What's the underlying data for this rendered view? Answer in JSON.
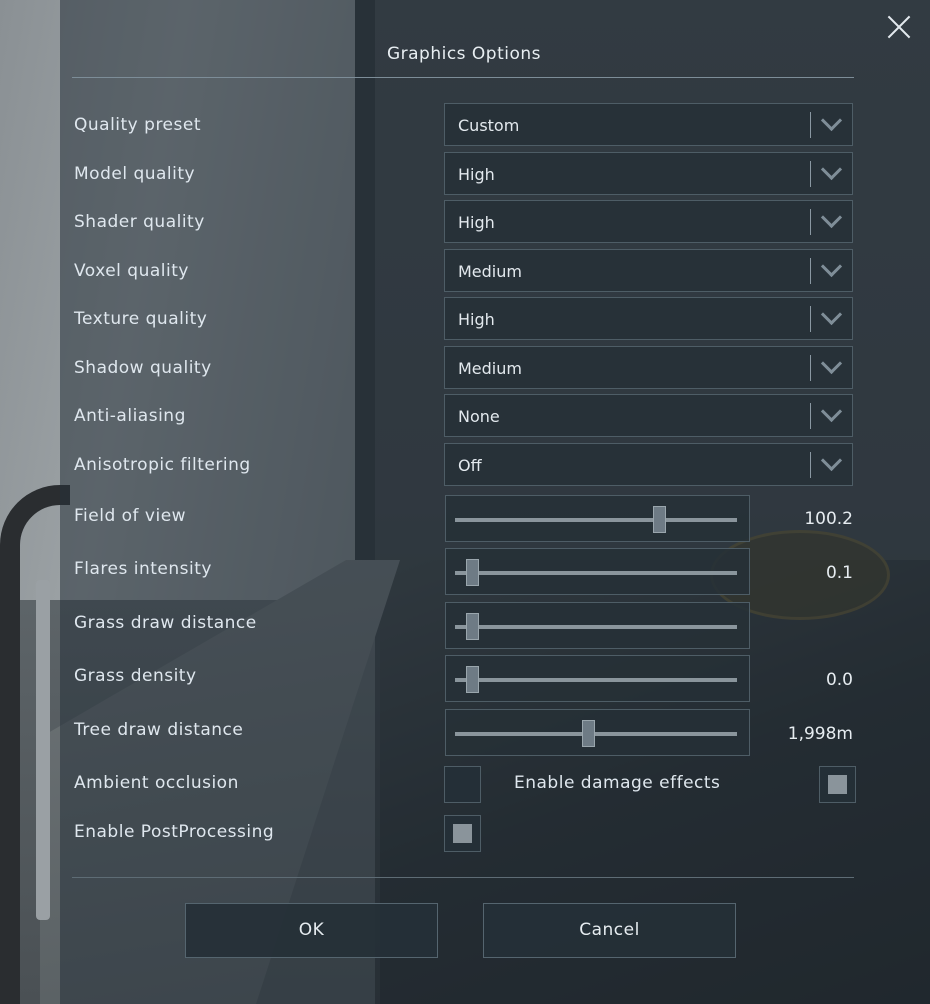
{
  "dialog": {
    "title": "Graphics Options"
  },
  "dropdowns": [
    {
      "label": "Quality preset",
      "value": "Custom"
    },
    {
      "label": "Model quality",
      "value": "High"
    },
    {
      "label": "Shader quality",
      "value": "High"
    },
    {
      "label": "Voxel quality",
      "value": "Medium"
    },
    {
      "label": "Texture quality",
      "value": "High"
    },
    {
      "label": "Shadow quality",
      "value": "Medium"
    },
    {
      "label": "Anti-aliasing",
      "value": "None"
    },
    {
      "label": "Anisotropic filtering",
      "value": "Off"
    }
  ],
  "sliders": [
    {
      "label": "Field of view",
      "value_text": "100.2",
      "fraction": 0.73
    },
    {
      "label": "Flares intensity",
      "value_text": "0.1",
      "fraction": 0.04
    },
    {
      "label": "Grass draw distance",
      "value_text": "",
      "fraction": 0.04
    },
    {
      "label": "Grass density",
      "value_text": "0.0",
      "fraction": 0.04
    },
    {
      "label": "Tree draw distance",
      "value_text": "1,998m",
      "fraction": 0.47
    }
  ],
  "checkboxes": {
    "ambient_occlusion": {
      "label": "Ambient occlusion",
      "checked": false
    },
    "damage_effects": {
      "label": "Enable damage effects",
      "checked": true
    },
    "post_processing": {
      "label": "Enable PostProcessing",
      "checked": true
    }
  },
  "buttons": {
    "ok": "OK",
    "cancel": "Cancel"
  },
  "icons": {
    "close": "close-icon",
    "dropdown": "chevron-down-icon"
  }
}
